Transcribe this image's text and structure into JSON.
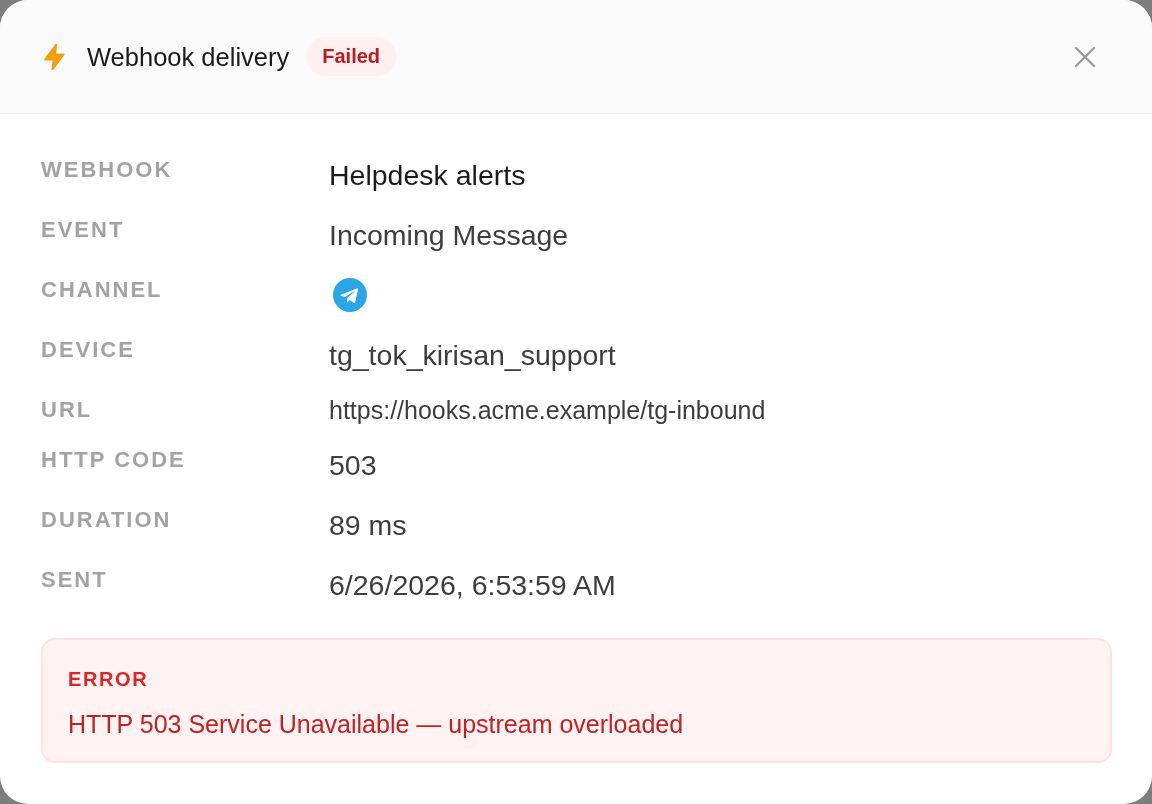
{
  "header": {
    "title": "Webhook delivery",
    "status": {
      "label": "Failed",
      "kind": "failed"
    }
  },
  "fields": [
    {
      "label": "WEBHOOK",
      "kind": "title",
      "value": "Helpdesk alerts"
    },
    {
      "label": "EVENT",
      "kind": "text",
      "value": "Incoming Message"
    },
    {
      "label": "CHANNEL",
      "kind": "icon"
    },
    {
      "label": "DEVICE",
      "kind": "text",
      "value": "tg_tok_kirisan_support"
    },
    {
      "label": "URL",
      "kind": "url",
      "value": "https://hooks.acme.example/tg-inbound"
    },
    {
      "label": "HTTP CODE",
      "kind": "text",
      "value": "503"
    },
    {
      "label": "DURATION",
      "kind": "text",
      "value": "89 ms"
    },
    {
      "label": "SENT",
      "kind": "text",
      "value": "6/26/2026, 6:53:59 AM"
    }
  ],
  "error": {
    "heading": "ERROR",
    "message": "HTTP 503 Service Unavailable — upstream overloaded"
  }
}
